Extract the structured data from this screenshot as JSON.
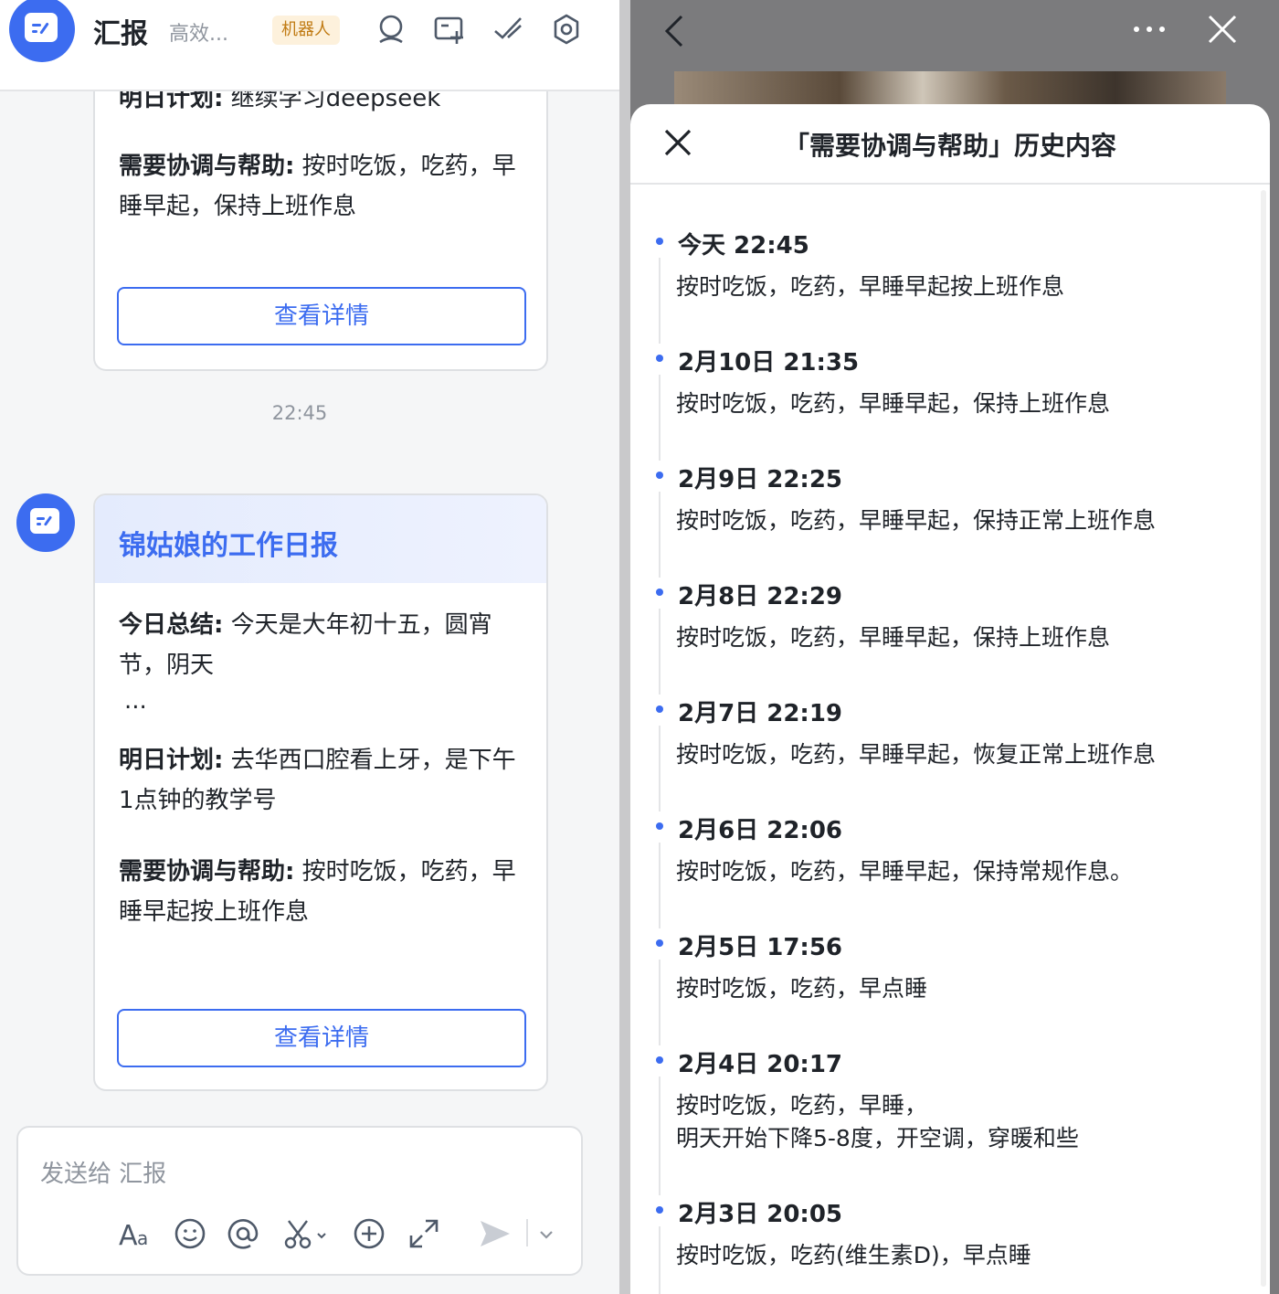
{
  "chat": {
    "app_title": "汇报",
    "app_subtitle": "高效...",
    "bot_badge": "机器人",
    "prev_card": {
      "plan_label": "明日计划:",
      "plan_text": "继续学习deepseek",
      "help_label": "需要协调与帮助:",
      "help_text": "按时吃饭，吃药，早睡早起，保持上班作息",
      "detail_button": "查看详情"
    },
    "time_separator": "22:45",
    "report_card": {
      "title": "锦姑娘的工作日报",
      "summary_label": "今日总结:",
      "summary_text": "今天是大年初十五，圆宵节，阴天",
      "ellipsis": "...",
      "plan_label": "明日计划:",
      "plan_text": "去华西口腔看上牙，是下午1点钟的教学号",
      "help_label": "需要协调与帮助:",
      "help_text": "按时吃饭，吃药，早睡早起按上班作息",
      "detail_button": "查看详情"
    },
    "composer": {
      "placeholder": "发送给 汇报"
    }
  },
  "history": {
    "title": "「需要协调与帮助」历史内容",
    "entries": [
      {
        "date": "今天 22:45",
        "text": "按时吃饭，吃药，早睡早起按上班作息"
      },
      {
        "date": "2月10日 21:35",
        "text": "按时吃饭，吃药，早睡早起，保持上班作息"
      },
      {
        "date": "2月9日 22:25",
        "text": "按时吃饭，吃药，早睡早起，保持正常上班作息"
      },
      {
        "date": "2月8日 22:29",
        "text": "按时吃饭，吃药，早睡早起，保持上班作息"
      },
      {
        "date": "2月7日 22:19",
        "text": "按时吃饭，吃药，早睡早起，恢复正常上班作息"
      },
      {
        "date": "2月6日 22:06",
        "text": "按时吃饭，吃药，早睡早起，保持常规作息。"
      },
      {
        "date": "2月5日 17:56",
        "text": "按时吃饭，吃药，早点睡"
      },
      {
        "date": "2月4日 20:17",
        "text": "按时吃饭，吃药，早睡，\n明天开始下降5-8度，开空调，穿暖和些"
      },
      {
        "date": "2月3日 20:05",
        "text": "按时吃饭，吃药(维生素D)，早点睡"
      }
    ]
  },
  "colors": {
    "accent": "#3c6cf0",
    "badge_text": "#c07a12",
    "badge_bg": "#fdf1dc"
  },
  "icons": [
    "app-logo-icon",
    "search-icon",
    "add-task-icon",
    "check-icon",
    "settings-icon",
    "back-icon",
    "more-icon",
    "close-icon",
    "font-icon",
    "emoji-icon",
    "mention-icon",
    "scissors-icon",
    "plus-circle-icon",
    "expand-icon",
    "send-icon",
    "chevron-down-icon"
  ]
}
